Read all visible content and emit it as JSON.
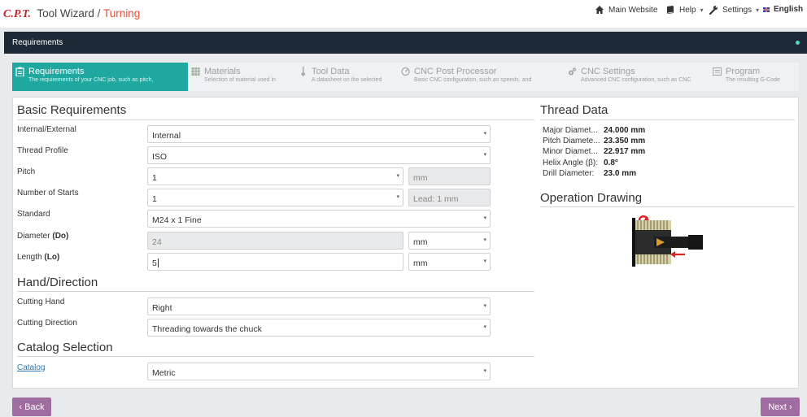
{
  "app": {
    "logo": "C.P.T.",
    "title": "Tool Wizard",
    "separator": "/",
    "subtitle": "Turning"
  },
  "nav": {
    "main_website": "Main Website",
    "help": "Help",
    "settings": "Settings",
    "language": "English",
    "caret": "▾"
  },
  "bar": {
    "title": "Requirements"
  },
  "steps": [
    {
      "title": "Requirements",
      "desc": "The requirements of your CNC job, such as pitch,",
      "icon": "clipboard-icon"
    },
    {
      "title": "Materials",
      "desc": "Selection of material used in",
      "icon": "materials-icon"
    },
    {
      "title": "Tool Data",
      "desc": "A datasheet on the selected",
      "icon": "tool-icon"
    },
    {
      "title": "CNC Post Processor",
      "desc": "Basic CNC configuration, such as speeds, and",
      "icon": "gauge-icon"
    },
    {
      "title": "CNC Settings",
      "desc": "Advanced CNC configuration, such as CNC",
      "icon": "gears-icon"
    },
    {
      "title": "Program",
      "desc": "The resulting G-Code",
      "icon": "program-icon"
    }
  ],
  "basic": {
    "title": "Basic Requirements",
    "internal_external": {
      "label": "Internal/External",
      "value": "Internal"
    },
    "thread_profile": {
      "label": "Thread Profile",
      "value": "ISO"
    },
    "pitch": {
      "label": "Pitch",
      "value": "1",
      "unit": "mm"
    },
    "starts": {
      "label": "Number of Starts",
      "value": "1",
      "lead": "Lead: 1 mm"
    },
    "standard": {
      "label": "Standard",
      "value": "M24 x 1 Fine"
    },
    "diameter": {
      "label": "Diameter",
      "label_sym": "(Do)",
      "value": "24",
      "unit": "mm"
    },
    "length": {
      "label": "Length",
      "label_sym": "(Lo)",
      "value": "5",
      "unit": "mm"
    }
  },
  "hand": {
    "title": "Hand/Direction",
    "cutting_hand": {
      "label": "Cutting Hand",
      "value": "Right"
    },
    "cutting_direction": {
      "label": "Cutting Direction",
      "value": "Threading towards the chuck"
    }
  },
  "catalog": {
    "title": "Catalog Selection",
    "label": "Catalog",
    "value": "Metric"
  },
  "thread_data": {
    "title": "Thread Data",
    "rows": [
      {
        "key": "Major Diamet...",
        "value": "24.000 mm"
      },
      {
        "key": "Pitch Diamete...",
        "value": "23.350 mm"
      },
      {
        "key": "Minor Diamet...",
        "value": "22.917 mm"
      },
      {
        "key": "Helix Angle (β):",
        "value": "0.8°"
      },
      {
        "key": "Drill Diameter:",
        "value": "23.0 mm"
      }
    ]
  },
  "drawing": {
    "title": "Operation Drawing"
  },
  "buttons": {
    "back": "‹ Back",
    "next": "Next ›"
  },
  "colors": {
    "accent": "#1fa8a0",
    "brand": "#c8242b",
    "dark_bar": "#1d2a35",
    "button": "#9e6c9f"
  }
}
